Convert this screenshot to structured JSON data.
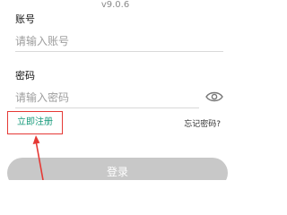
{
  "app": {
    "version": "v9.0.6"
  },
  "account": {
    "label": "账号",
    "placeholder": "请输入账号"
  },
  "password": {
    "label": "密码",
    "placeholder": "请输入密码"
  },
  "links": {
    "register": "立即注册",
    "forgot": "忘记密码?"
  },
  "login": {
    "label": "登录"
  },
  "colors": {
    "register_link": "#179a7b",
    "annotation": "#e53935",
    "login_button": "#c8c8c8"
  },
  "icons": {
    "password_visibility": "eye-icon",
    "annotation_arrow": "arrow-up-icon"
  }
}
